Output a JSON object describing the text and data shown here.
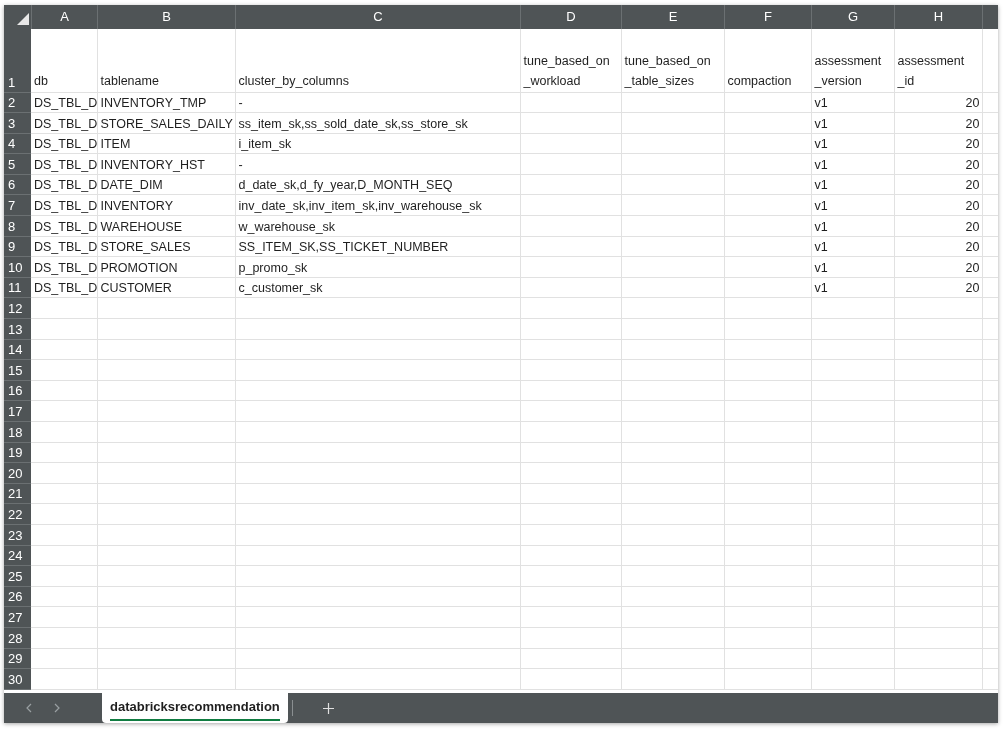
{
  "columns": [
    {
      "letter": "A"
    },
    {
      "letter": "B"
    },
    {
      "letter": "C"
    },
    {
      "letter": "D"
    },
    {
      "letter": "E"
    },
    {
      "letter": "F"
    },
    {
      "letter": "G"
    },
    {
      "letter": "H",
      "numeric": true
    }
  ],
  "header_row": {
    "number": "1",
    "cells": {
      "A": "db",
      "B": "tablename",
      "C": "cluster_by_columns",
      "D": "tune_based_on_workload",
      "E": "tune_based_on_table_sizes",
      "F": "compaction",
      "G": "assessment_version",
      "H": "assessment_id"
    }
  },
  "rows": [
    {
      "number": "2",
      "cells": {
        "A": "DS_TBL_D",
        "B": "INVENTORY_TMP",
        "C": "-",
        "G": "v1",
        "H": "20"
      }
    },
    {
      "number": "3",
      "cells": {
        "A": "DS_TBL_D",
        "B": "STORE_SALES_DAILY",
        "C": "ss_item_sk,ss_sold_date_sk,ss_store_sk",
        "G": "v1",
        "H": "20"
      }
    },
    {
      "number": "4",
      "cells": {
        "A": "DS_TBL_D",
        "B": "ITEM",
        "C": "i_item_sk",
        "G": "v1",
        "H": "20"
      }
    },
    {
      "number": "5",
      "cells": {
        "A": "DS_TBL_D",
        "B": "INVENTORY_HST",
        "C": "-",
        "G": "v1",
        "H": "20"
      }
    },
    {
      "number": "6",
      "cells": {
        "A": "DS_TBL_D",
        "B": "DATE_DIM",
        "C": "d_date_sk,d_fy_year,D_MONTH_SEQ",
        "G": "v1",
        "H": "20"
      }
    },
    {
      "number": "7",
      "cells": {
        "A": "DS_TBL_D",
        "B": "INVENTORY",
        "C": "inv_date_sk,inv_item_sk,inv_warehouse_sk",
        "G": "v1",
        "H": "20"
      }
    },
    {
      "number": "8",
      "cells": {
        "A": "DS_TBL_D",
        "B": "WAREHOUSE",
        "C": "w_warehouse_sk",
        "G": "v1",
        "H": "20"
      }
    },
    {
      "number": "9",
      "cells": {
        "A": "DS_TBL_D",
        "B": "STORE_SALES",
        "C": "SS_ITEM_SK,SS_TICKET_NUMBER",
        "G": "v1",
        "H": "20"
      }
    },
    {
      "number": "10",
      "cells": {
        "A": "DS_TBL_D",
        "B": "PROMOTION",
        "C": "p_promo_sk",
        "G": "v1",
        "H": "20"
      }
    },
    {
      "number": "11",
      "cells": {
        "A": "DS_TBL_D",
        "B": "CUSTOMER",
        "C": "c_customer_sk",
        "G": "v1",
        "H": "20"
      }
    },
    {
      "number": "12"
    },
    {
      "number": "13"
    },
    {
      "number": "14"
    },
    {
      "number": "15"
    },
    {
      "number": "16"
    },
    {
      "number": "17"
    },
    {
      "number": "18"
    },
    {
      "number": "19"
    },
    {
      "number": "20"
    },
    {
      "number": "21"
    },
    {
      "number": "22"
    },
    {
      "number": "23"
    },
    {
      "number": "24"
    },
    {
      "number": "25"
    },
    {
      "number": "26"
    },
    {
      "number": "27"
    },
    {
      "number": "28"
    },
    {
      "number": "29"
    },
    {
      "number": "30"
    }
  ],
  "sheet_tabs": [
    {
      "label": "databricksrecommendation",
      "selected": true
    }
  ]
}
